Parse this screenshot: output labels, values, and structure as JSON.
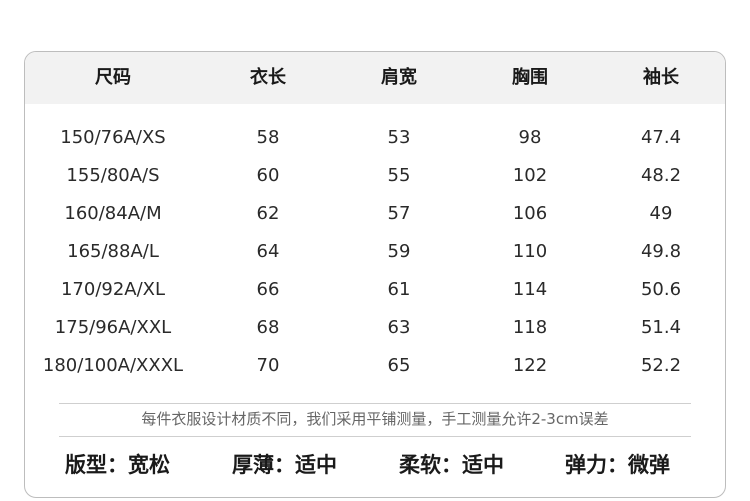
{
  "table": {
    "headers": [
      "尺码",
      "衣长",
      "肩宽",
      "胸围",
      "袖长"
    ],
    "rows": [
      [
        "150/76A/XS",
        "58",
        "53",
        "98",
        "47.4"
      ],
      [
        "155/80A/S",
        "60",
        "55",
        "102",
        "48.2"
      ],
      [
        "160/84A/M",
        "62",
        "57",
        "106",
        "49"
      ],
      [
        "165/88A/L",
        "64",
        "59",
        "110",
        "49.8"
      ],
      [
        "170/92A/XL",
        "66",
        "61",
        "114",
        "50.6"
      ],
      [
        "175/96A/XXL",
        "68",
        "63",
        "118",
        "51.4"
      ],
      [
        "180/100A/XXXL",
        "70",
        "65",
        "122",
        "52.2"
      ]
    ]
  },
  "note": "每件衣服设计材质不同，我们采用平铺测量，手工测量允许2-3cm误差",
  "attributes": [
    "版型：宽松",
    "厚薄：适中",
    "柔软：适中",
    "弹力：微弹"
  ]
}
